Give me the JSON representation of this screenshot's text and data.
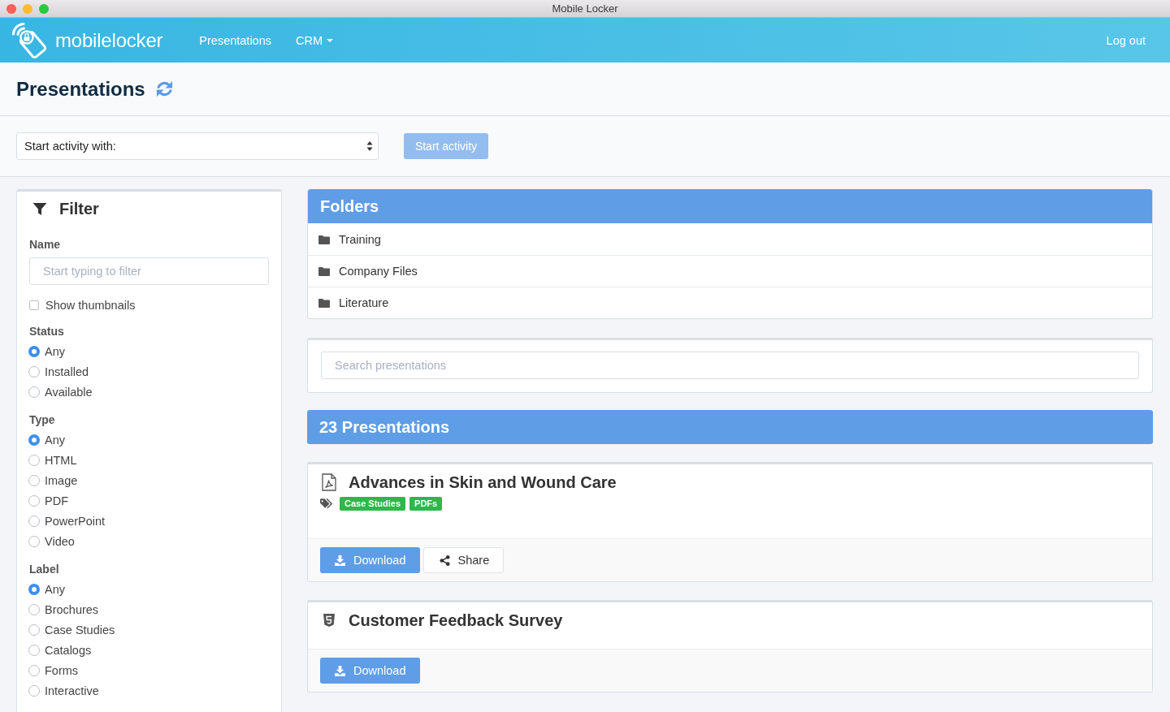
{
  "window": {
    "title": "Mobile Locker"
  },
  "navbar": {
    "brand": "mobilelocker",
    "items": [
      {
        "label": "Presentations",
        "kind": "link"
      },
      {
        "label": "CRM",
        "kind": "dropdown"
      }
    ],
    "logout": "Log out"
  },
  "page_header": {
    "title": "Presentations"
  },
  "activity": {
    "select": {
      "value": "Start activity with:"
    },
    "button": {
      "label": "Start activity",
      "disabled": true
    }
  },
  "filter": {
    "title": "Filter",
    "name": {
      "label": "Name",
      "placeholder": "Start typing to filter"
    },
    "show_thumbnails": {
      "label": "Show thumbnails",
      "checked": false
    },
    "groups": [
      {
        "heading": "Status",
        "options": [
          {
            "label": "Any",
            "selected": true
          },
          {
            "label": "Installed",
            "selected": false
          },
          {
            "label": "Available",
            "selected": false
          }
        ]
      },
      {
        "heading": "Type",
        "options": [
          {
            "label": "Any",
            "selected": true
          },
          {
            "label": "HTML",
            "selected": false
          },
          {
            "label": "Image",
            "selected": false
          },
          {
            "label": "PDF",
            "selected": false
          },
          {
            "label": "PowerPoint",
            "selected": false
          },
          {
            "label": "Video",
            "selected": false
          }
        ]
      },
      {
        "heading": "Label",
        "options": [
          {
            "label": "Any",
            "selected": true
          },
          {
            "label": "Brochures",
            "selected": false
          },
          {
            "label": "Case Studies",
            "selected": false
          },
          {
            "label": "Catalogs",
            "selected": false
          },
          {
            "label": "Forms",
            "selected": false
          },
          {
            "label": "Interactive",
            "selected": false
          }
        ]
      }
    ]
  },
  "folders": {
    "title": "Folders",
    "items": [
      "Training",
      "Company Files",
      "Literature"
    ]
  },
  "search": {
    "placeholder": "Search presentations"
  },
  "presentations": {
    "count_title": "23 Presentations",
    "items": [
      {
        "title": "Advances in Skin and Wound Care",
        "kind": "pdf",
        "tags": [
          "Case Studies",
          "PDFs"
        ],
        "actions": [
          {
            "label": "Download",
            "kind": "download"
          },
          {
            "label": "Share",
            "kind": "share"
          }
        ]
      },
      {
        "title": "Customer Feedback Survey",
        "kind": "html",
        "actions": [
          {
            "label": "Download",
            "kind": "download"
          }
        ]
      }
    ]
  }
}
